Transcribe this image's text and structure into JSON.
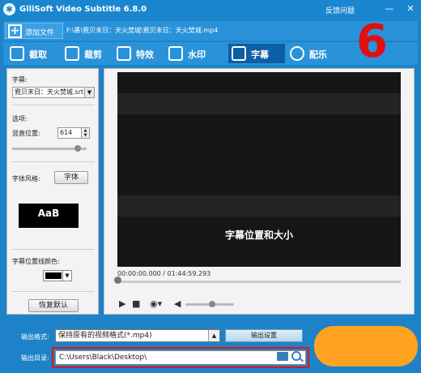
{
  "titlebar": {
    "title": "GiliSoft Video Subtitle 6.8.0",
    "feedback": "反馈问题",
    "minimize": "—",
    "close": "✕"
  },
  "addbar": {
    "add_label": "添加文件",
    "file_path": "F:\\裹\\霓贝末日：天火焚城\\霓贝末日：天火焚城.mp4"
  },
  "tabs": [
    {
      "label": "截取"
    },
    {
      "label": "裁剪"
    },
    {
      "label": "特效"
    },
    {
      "label": "水印"
    },
    {
      "label": "字幕"
    },
    {
      "label": "配乐"
    }
  ],
  "step_number": "6",
  "left": {
    "subtitle_label": "字幕:",
    "subtitle_file": "霓贝末日：天火焚城.srt",
    "options_label": "选项:",
    "vpos_label": "竖直位置:",
    "vpos_value": "614",
    "vpos_level": 0.88,
    "font_style_label": "字体风格:",
    "font_button": "字体",
    "preview_text": "AaB",
    "line_color_label": "字幕位置线颜色:",
    "line_color": "#000000",
    "reset_button": "恢复默认"
  },
  "player": {
    "subtitle_text": "字幕位置和大小",
    "time": "00:00:00.000 / 01:44:59.293",
    "volume_level": 0.55
  },
  "bottom": {
    "format_label": "输出格式:",
    "format_value": "保持原有的视频格式(*.mp4)",
    "export_button": "输出设置",
    "dir_label": "输出目录:",
    "dir_value": "C:\\Users\\Black\\Desktop\\"
  },
  "colors": {
    "accent": "#1a86cf",
    "highlight_red": "#e01515",
    "orange": "#ffa21f"
  }
}
